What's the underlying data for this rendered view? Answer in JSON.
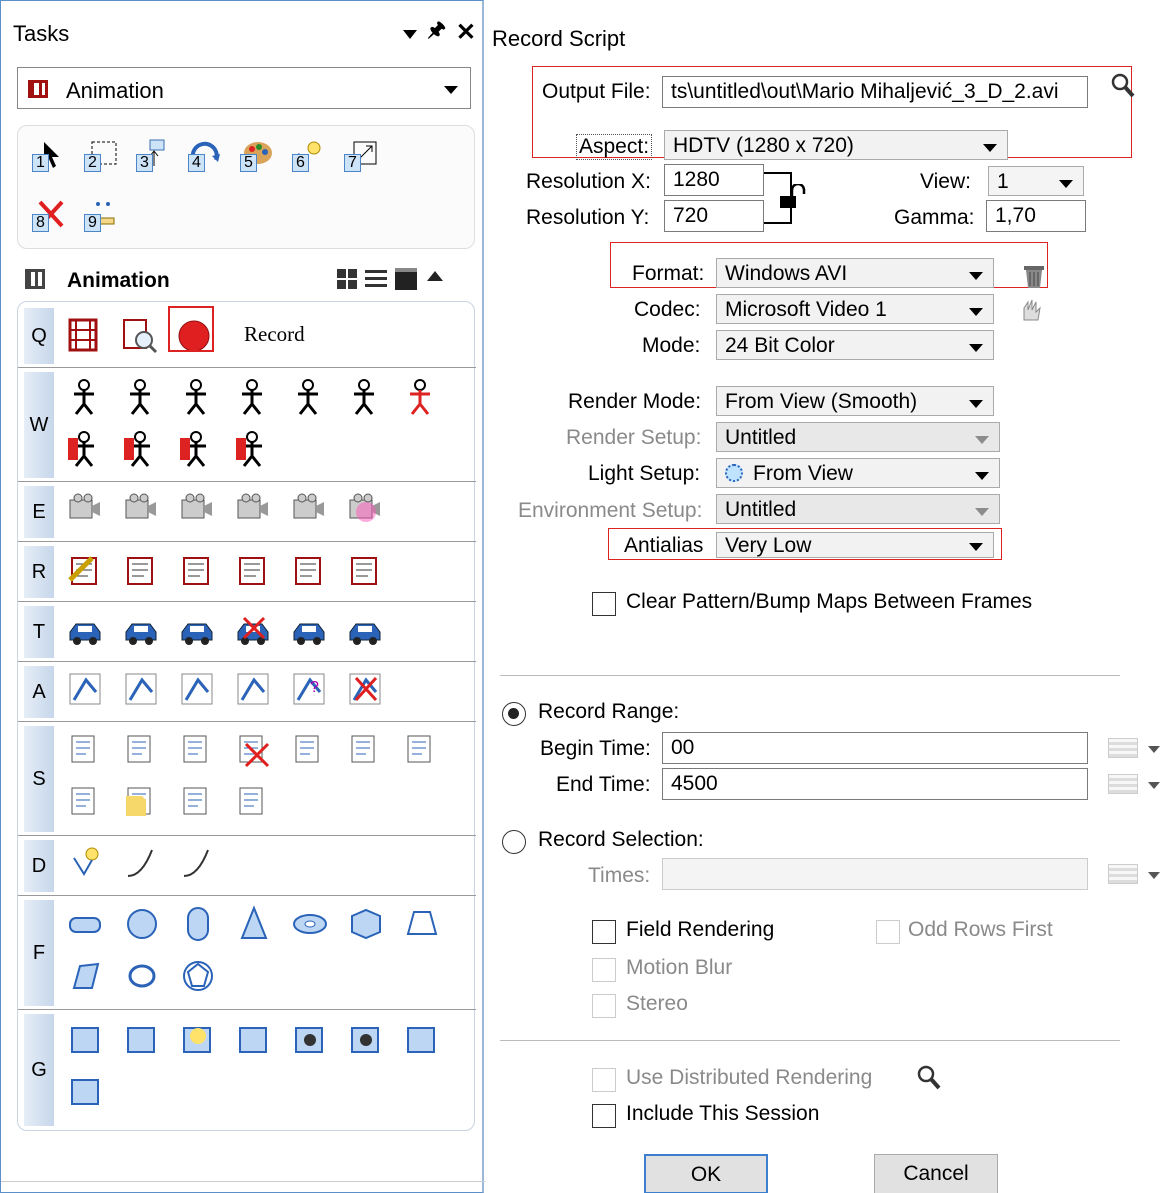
{
  "tasks": {
    "title": "Tasks",
    "pin_glyph": "↓",
    "close_glyph": "✕",
    "dropdown_value": "Animation",
    "quick_numbers": [
      "1",
      "2",
      "3",
      "4",
      "5",
      "6",
      "7",
      "8",
      "9"
    ],
    "section_title": "Animation",
    "rows": [
      "Q",
      "W",
      "E",
      "R",
      "T",
      "A",
      "S",
      "D",
      "F",
      "G"
    ],
    "record_note": "Record"
  },
  "dialog": {
    "title": "Record Script",
    "output_file_label": "Output File:",
    "output_file_value": "ts\\untitled\\out\\Mario Mihaljević_3_D_2.avi",
    "aspect_label": "Aspect:",
    "aspect_value": "HDTV (1280 x 720)",
    "resx_label": "Resolution X:",
    "resx_value": "1280",
    "resy_label": "Resolution Y:",
    "resy_value": "720",
    "view_label": "View:",
    "view_value": "1",
    "gamma_label": "Gamma:",
    "gamma_value": "1,70",
    "format_label": "Format:",
    "format_value": "Windows AVI",
    "codec_label": "Codec:",
    "codec_value": "Microsoft Video 1",
    "mode_label": "Mode:",
    "mode_value": "24 Bit Color",
    "render_mode_label": "Render Mode:",
    "render_mode_value": "From View (Smooth)",
    "render_setup_label": "Render Setup:",
    "render_setup_value": "Untitled",
    "light_setup_label": "Light Setup:",
    "light_setup_value": "From View",
    "env_setup_label": "Environment Setup:",
    "env_setup_value": "Untitled",
    "antialias_label": "Antialias",
    "antialias_value": "Very Low",
    "clear_maps_label": "Clear Pattern/Bump Maps Between Frames",
    "record_range_label": "Record Range:",
    "begin_time_label": "Begin Time:",
    "begin_time_value": "00",
    "end_time_label": "End Time:",
    "end_time_value": "4500",
    "record_selection_label": "Record Selection:",
    "times_label": "Times:",
    "field_rendering_label": "Field Rendering",
    "odd_rows_label": "Odd Rows First",
    "motion_blur_label": "Motion Blur",
    "stereo_label": "Stereo",
    "distributed_label": "Use Distributed Rendering",
    "include_session_label": "Include This Session",
    "ok_label": "OK",
    "cancel_label": "Cancel",
    "selected_range": "record-range"
  }
}
